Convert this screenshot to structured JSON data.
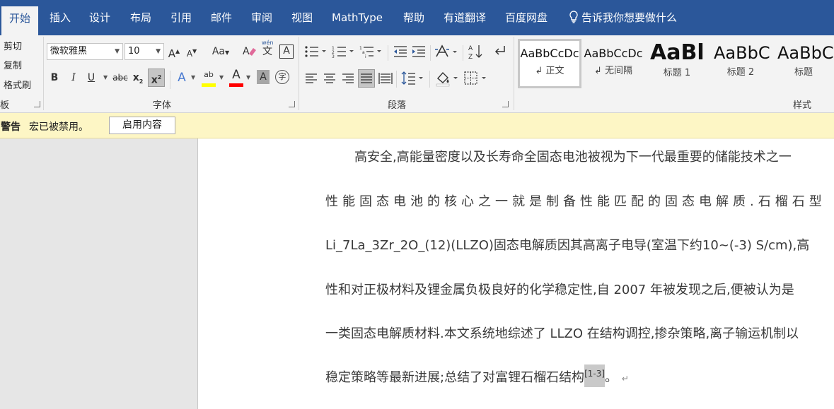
{
  "menu": {
    "tabs": [
      {
        "label": "开始",
        "active": true
      },
      {
        "label": "插入"
      },
      {
        "label": "设计"
      },
      {
        "label": "布局"
      },
      {
        "label": "引用"
      },
      {
        "label": "邮件"
      },
      {
        "label": "审阅"
      },
      {
        "label": "视图"
      },
      {
        "label": "MathType"
      },
      {
        "label": "帮助"
      },
      {
        "label": "有道翻译"
      },
      {
        "label": "百度网盘"
      }
    ],
    "tell_me": "告诉我你想要做什么"
  },
  "clipboard": {
    "cut": "剪切",
    "copy": "复制",
    "format_painter": "格式刷",
    "group_label": "板"
  },
  "font": {
    "name": "微软雅黑",
    "size": "10",
    "grow": "A",
    "shrink": "A",
    "case": "Aa",
    "phonetic": "wén",
    "phonetic_char": "文",
    "border_char": "A",
    "bold": "B",
    "italic": "I",
    "underline": "U",
    "strike": "abc",
    "subscript": "x",
    "subscript_mark": "2",
    "superscript": "x",
    "superscript_mark": "2",
    "effect": "A",
    "highlight": "ab",
    "color": "A",
    "shading": "A",
    "enclose": "字",
    "group_label": "字体"
  },
  "paragraph": {
    "group_label": "段落"
  },
  "styles": {
    "items": [
      {
        "preview": "AaBbCcDc",
        "name": "↲ 正文",
        "selected": true
      },
      {
        "preview": "AaBbCcDc",
        "name": "↲ 无间隔"
      },
      {
        "preview": "AaBl",
        "name": "标题 1"
      },
      {
        "preview": "AaBbC",
        "name": "标题 2"
      },
      {
        "preview": "AaBbC",
        "name": "标题"
      }
    ],
    "group_label": "样式"
  },
  "message_bar": {
    "title": "警告",
    "text": "宏已被禁用。",
    "button": "启用内容"
  },
  "document": {
    "lines": [
      "高安全,高能量密度以及长寿命全固态电池被视为下一代最重要的储能技术之一",
      "性能固态电池的核心之一就是制备性能匹配的固态电解质.石榴石型",
      "Li_7La_3Zr_2O_(12)(LLZO)固态电解质因其高离子电导(室温下约10~(-3) S/cm),高",
      "性和对正极材料及锂金属负极良好的化学稳定性,自 2007 年被发现之后,便被认为是",
      "一类固态电解质材料.本文系统地综述了 LLZO 在结构调控,掺杂策略,离子输运机制以",
      "稳定策略等最新进展;总结了对富锂石榴石结构"
    ],
    "citation": "[1-3]",
    "end_text": "。",
    "para_mark": "↵"
  },
  "colors": {
    "menu_bg": "#2b579a",
    "highlight_yellow": "#ffff00",
    "font_red": "#ff0000",
    "message_bg": "#fdf6c5"
  }
}
